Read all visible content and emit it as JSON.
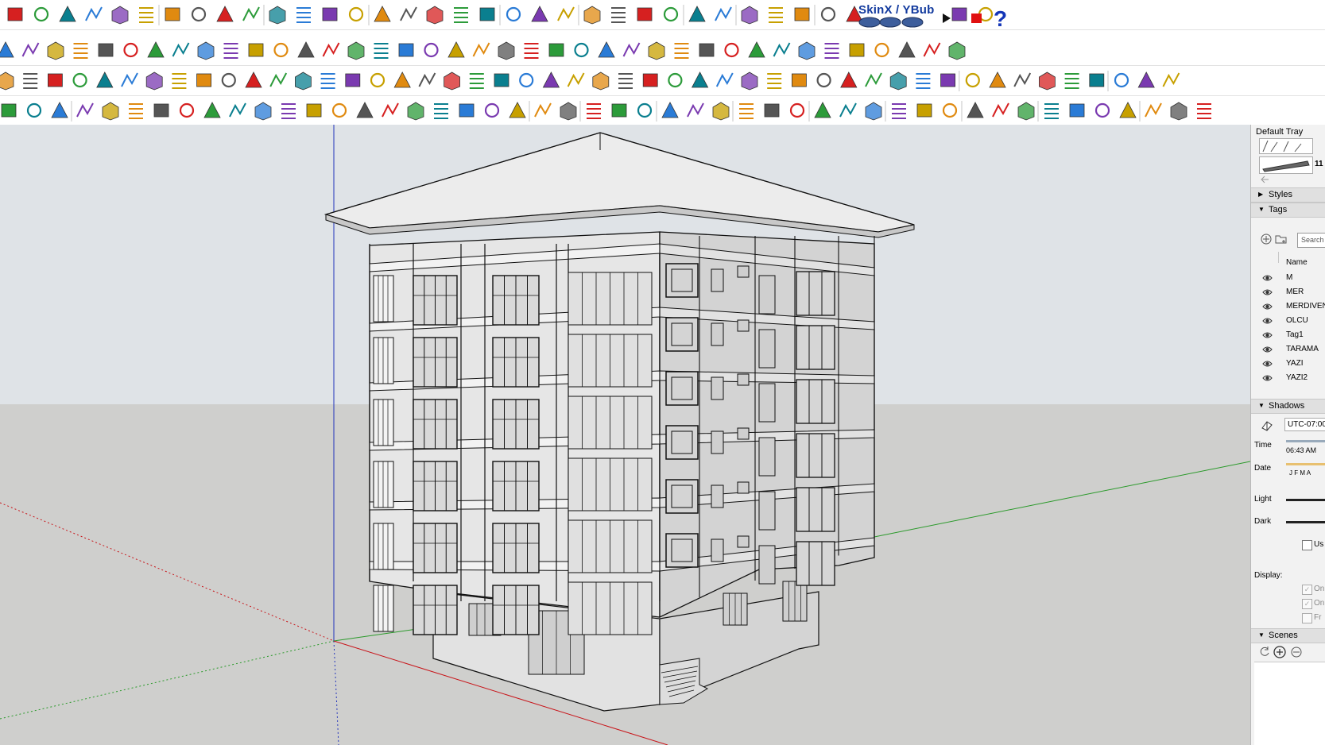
{
  "toolbar": {
    "skin_label": "SkinX / YBub"
  },
  "tray": {
    "title": "Default Tray",
    "style_thumb_value": "11",
    "styles_label": "Styles",
    "tags_label": "Tags",
    "search_placeholder": "Search",
    "name_header": "Name",
    "tags": [
      "M",
      "MER",
      "MERDIVEN",
      "OLCU",
      "Tag1",
      "TARAMA",
      "YAZI",
      "YAZI2"
    ],
    "shadows_label": "Shadows",
    "utc_value": "UTC-07:00",
    "time_label": "Time",
    "time_value": "06:43 AM",
    "date_label": "Date",
    "months": "J  F  M  A",
    "light_label": "Light",
    "dark_label": "Dark",
    "use_sun_label": "Us",
    "display_label": "Display:",
    "display_options": [
      "On",
      "On",
      "Fr"
    ],
    "scenes_label": "Scenes"
  },
  "colors": {
    "sky": "#dfe3e7",
    "ground": "#cfcfcd",
    "building_face": "#e4e4e4",
    "axis_red": "#c8151a",
    "axis_green": "#2b9a2b",
    "axis_blue": "#2233bb"
  }
}
